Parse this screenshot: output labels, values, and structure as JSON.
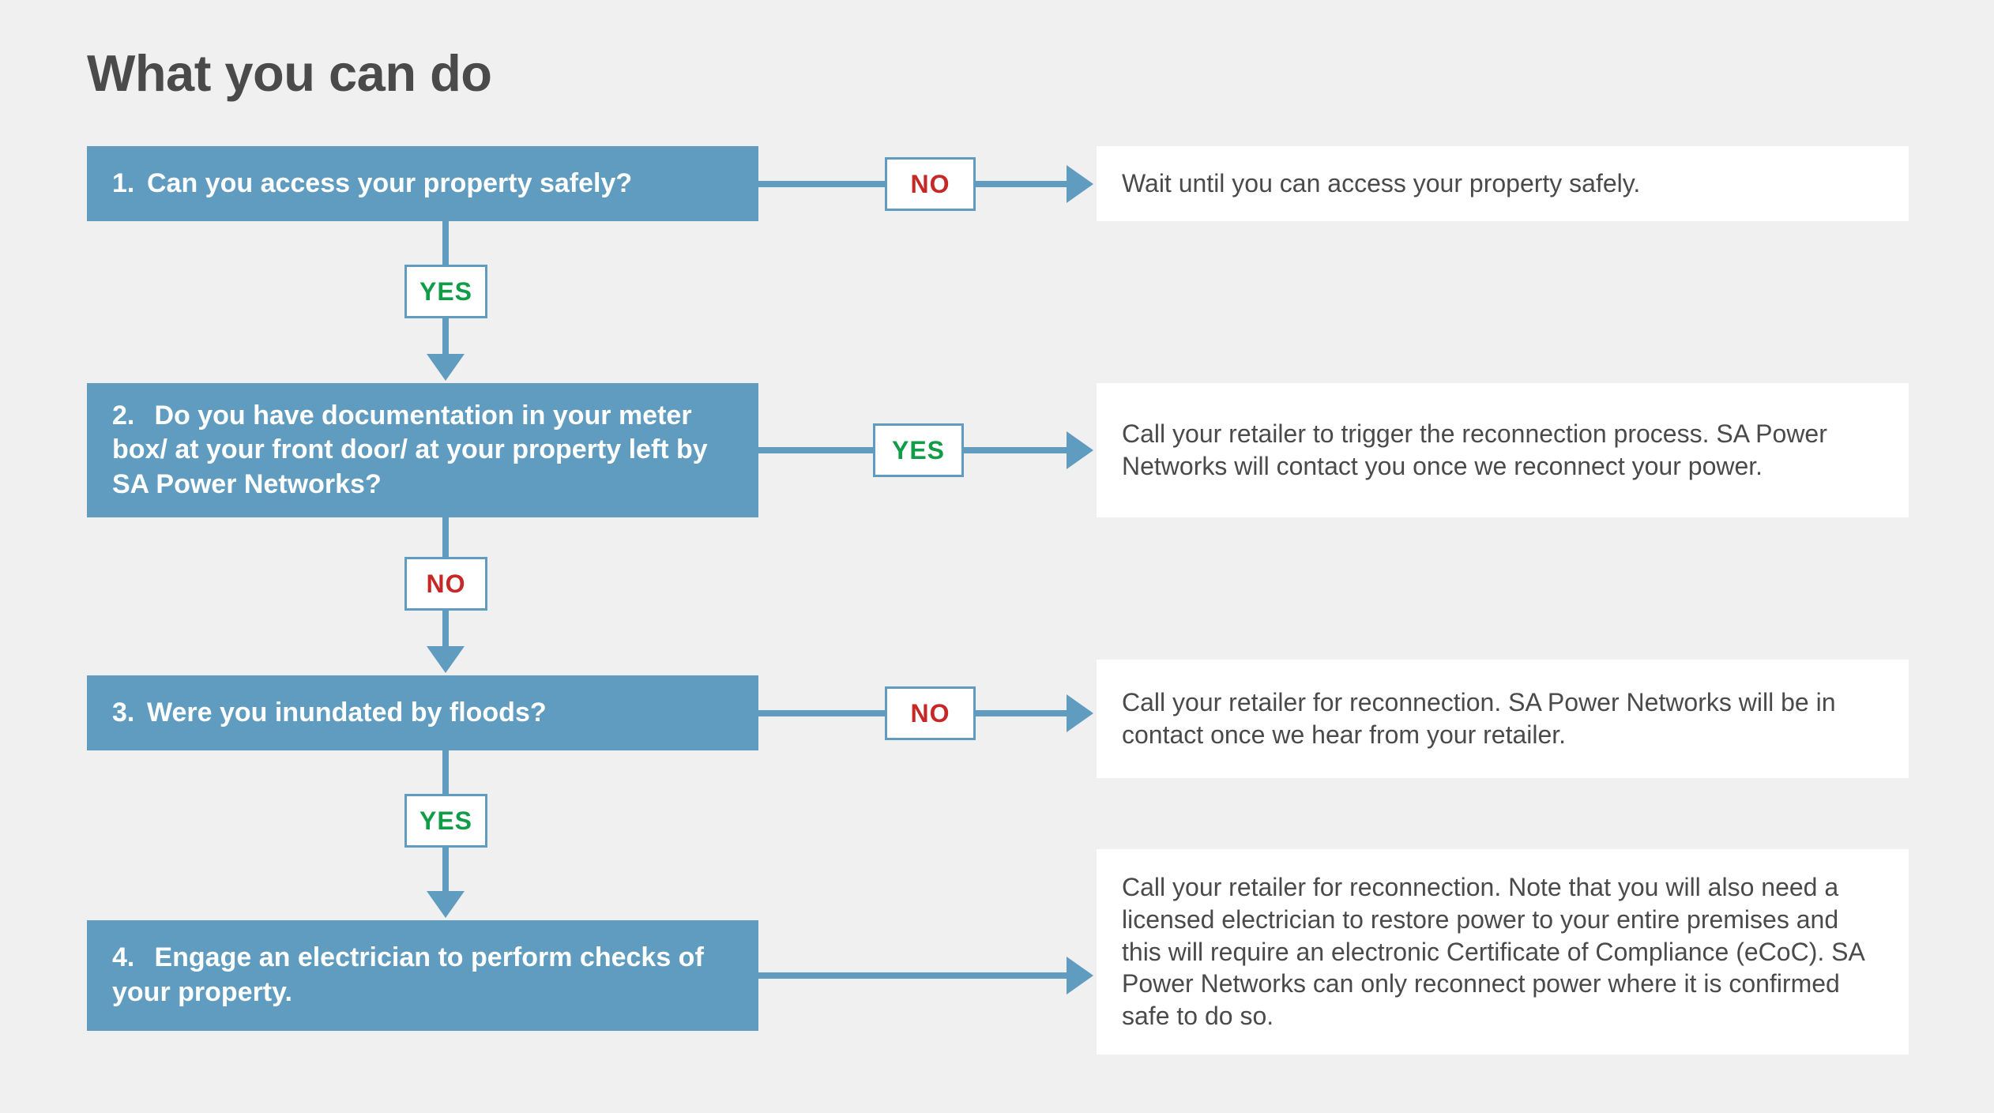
{
  "title": "What you can do",
  "steps": {
    "q1": {
      "num": "1.",
      "text": "Can you access your property safely?"
    },
    "q2": {
      "num": "2.",
      "text": "Do you have documentation in your meter box/ at your front door/ at your property left by SA Power Networks?"
    },
    "q3": {
      "num": "3.",
      "text": "Were you inundated by floods?"
    },
    "q4": {
      "num": "4.",
      "text": "Engage an electrician to perform checks of your property."
    }
  },
  "decisions": {
    "q1_right": "NO",
    "q1_down": "YES",
    "q2_right": "YES",
    "q2_down": "NO",
    "q3_right": "NO",
    "q3_down": "YES"
  },
  "outcomes": {
    "o1": "Wait until you can access your property safely.",
    "o2": "Call your retailer to trigger the reconnection process. SA Power Networks will contact you once we reconnect your power.",
    "o3": "Call your retailer for reconnection. SA Power Networks will be in contact once we hear from your retailer.",
    "o4": "Call your retailer for reconnection. Note that you will also need a licensed electrician to restore power to your entire premises and this will require an electronic Certificate of Compliance (eCoC). SA Power Networks can only reconnect power where it is confirmed safe to do so."
  }
}
